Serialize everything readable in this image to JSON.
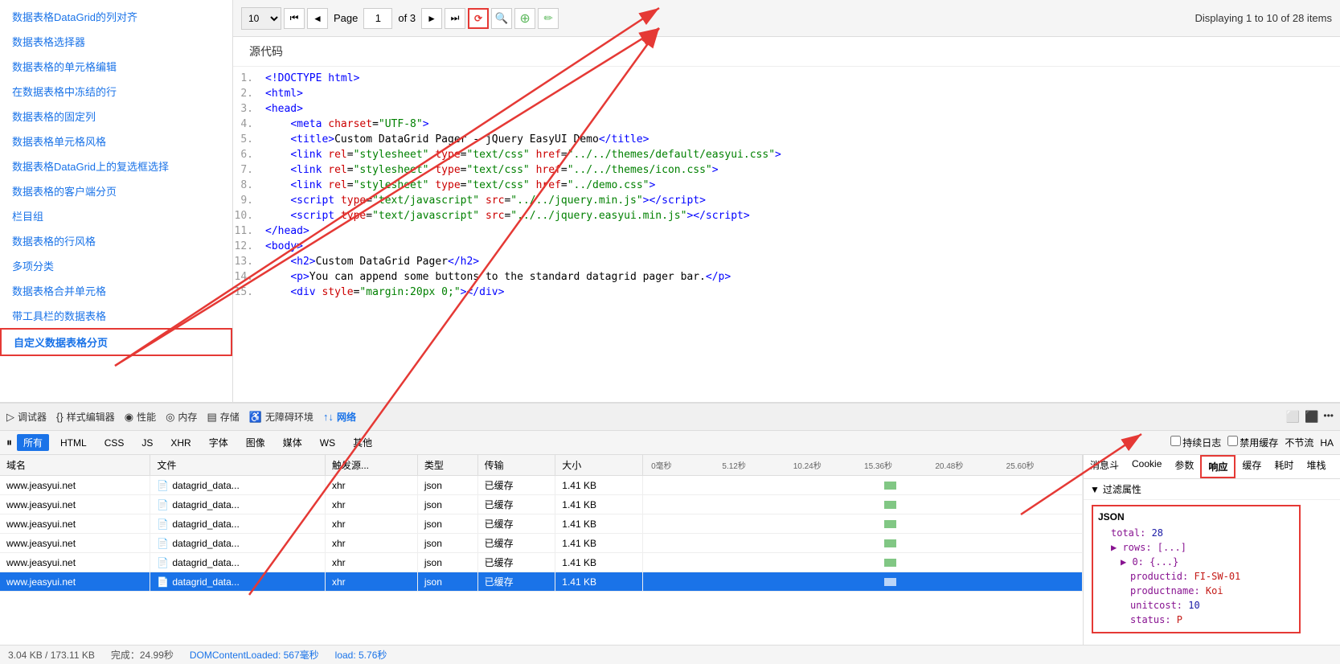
{
  "sidebar": {
    "items": [
      {
        "label": "数据表格DataGrid的列对齐",
        "active": false
      },
      {
        "label": "数据表格选择器",
        "active": false
      },
      {
        "label": "数据表格的单元格编辑",
        "active": false
      },
      {
        "label": "在数据表格中冻结的行",
        "active": false
      },
      {
        "label": "数据表格的固定列",
        "active": false
      },
      {
        "label": "数据表格单元格风格",
        "active": false
      },
      {
        "label": "数据表格DataGrid上的复选框选择",
        "active": false
      },
      {
        "label": "数据表格的客户端分页",
        "active": false
      },
      {
        "label": "栏目组",
        "active": false
      },
      {
        "label": "数据表格的行风格",
        "active": false
      },
      {
        "label": "多项分类",
        "active": false
      },
      {
        "label": "数据表格合并单元格",
        "active": false
      },
      {
        "label": "带工具栏的数据表格",
        "active": false
      },
      {
        "label": "自定义数据表格分页",
        "active": true
      }
    ]
  },
  "pager": {
    "page_size": "10",
    "current_page": "1",
    "of_label": "of 3",
    "display_text": "Displaying 1 to 10 of 28 items"
  },
  "source": {
    "header": "源代码",
    "lines": [
      {
        "num": "1.",
        "html": "<span class='code-blue'>&lt;!DOCTYPE html&gt;</span>"
      },
      {
        "num": "2.",
        "html": "<span class='code-blue'>&lt;html&gt;</span>"
      },
      {
        "num": "3.",
        "html": "<span class='code-blue'>&lt;head&gt;</span>"
      },
      {
        "num": "4.",
        "html": "    <span class='code-blue'>&lt;meta</span> <span class='code-red'>charset</span><span class='code-black'>=</span><span class='code-green'>\"UTF-8\"</span><span class='code-blue'>&gt;</span>"
      },
      {
        "num": "5.",
        "html": "    <span class='code-blue'>&lt;title&gt;</span><span class='code-black'>Custom DataGrid Pager - jQuery EasyUI Demo</span><span class='code-blue'>&lt;/title&gt;</span>"
      },
      {
        "num": "6.",
        "html": "    <span class='code-blue'>&lt;link</span> <span class='code-red'>rel</span><span class='code-black'>=</span><span class='code-green'>\"stylesheet\"</span> <span class='code-red'>type</span><span class='code-black'>=</span><span class='code-green'>\"text/css\"</span> <span class='code-red'>href</span><span class='code-black'>=</span><span class='code-green'>\"../../themes/default/easyui.css\"</span><span class='code-blue'>&gt;</span>"
      },
      {
        "num": "7.",
        "html": "    <span class='code-blue'>&lt;link</span> <span class='code-red'>rel</span><span class='code-black'>=</span><span class='code-green'>\"stylesheet\"</span> <span class='code-red'>type</span><span class='code-black'>=</span><span class='code-green'>\"text/css\"</span> <span class='code-red'>href</span><span class='code-black'>=</span><span class='code-green'>\"../../themes/icon.css\"</span><span class='code-blue'>&gt;</span>"
      },
      {
        "num": "8.",
        "html": "    <span class='code-blue'>&lt;link</span> <span class='code-red'>rel</span><span class='code-black'>=</span><span class='code-green'>\"stylesheet\"</span> <span class='code-red'>type</span><span class='code-black'>=</span><span class='code-green'>\"text/css\"</span> <span class='code-red'>href</span><span class='code-black'>=</span><span class='code-green'>\"../demo.css\"</span><span class='code-blue'>&gt;</span>"
      },
      {
        "num": "9.",
        "html": "    <span class='code-blue'>&lt;script</span> <span class='code-red'>type</span><span class='code-black'>=</span><span class='code-green'>\"text/javascript\"</span> <span class='code-red'>src</span><span class='code-black'>=</span><span class='code-green'>\"../../jquery.min.js\"</span><span class='code-blue'>&gt;&lt;/script&gt;</span>"
      },
      {
        "num": "10.",
        "html": "    <span class='code-blue'>&lt;script</span> <span class='code-red'>type</span><span class='code-black'>=</span><span class='code-green'>\"text/javascript\"</span> <span class='code-red'>src</span><span class='code-black'>=</span><span class='code-green'>\"../../jquery.easyui.min.js\"</span><span class='code-blue'>&gt;&lt;/script&gt;</span>"
      },
      {
        "num": "11.",
        "html": "<span class='code-blue'>&lt;/head&gt;</span>"
      },
      {
        "num": "12.",
        "html": "<span class='code-blue'>&lt;body&gt;</span>"
      },
      {
        "num": "13.",
        "html": "    <span class='code-blue'>&lt;h2&gt;</span><span class='code-black'>Custom DataGrid Pager</span><span class='code-blue'>&lt;/h2&gt;</span>"
      },
      {
        "num": "14.",
        "html": "    <span class='code-blue'>&lt;p&gt;</span><span class='code-black'>You can append some buttons to the standard datagrid pager bar.</span><span class='code-blue'>&lt;/p&gt;</span>"
      },
      {
        "num": "15.",
        "html": "    <span class='code-blue'>&lt;div</span> <span class='code-red'>style</span><span class='code-black'>=</span><span class='code-green'>\"margin:20px 0;\"</span><span class='code-blue'>&gt;&lt;/div&gt;</span>"
      }
    ]
  },
  "devtools": {
    "tools": [
      {
        "label": "调试器",
        "icon": "▷"
      },
      {
        "label": "样式编辑器",
        "icon": "{}"
      },
      {
        "label": "性能",
        "icon": "◉"
      },
      {
        "label": "内存",
        "icon": "◎"
      },
      {
        "label": "存储",
        "icon": "▤"
      },
      {
        "label": "无障碍环境",
        "icon": "♿"
      },
      {
        "label": "网络",
        "icon": "↑↓",
        "active": true
      }
    ]
  },
  "network": {
    "tabs": [
      "所有",
      "HTML",
      "CSS",
      "JS",
      "XHR",
      "字体",
      "图像",
      "媒体",
      "WS",
      "其他"
    ],
    "active_tab": "所有",
    "checkboxes": [
      {
        "label": "持续日志"
      },
      {
        "label": "禁用缓存"
      },
      {
        "label": "不节流"
      },
      {
        "label": "HA"
      }
    ],
    "columns": [
      "域名",
      "文件",
      "触发源...",
      "类型",
      "传输",
      "大小"
    ],
    "timeline_labels": [
      "0毫秒",
      "5.12秒",
      "10.24秒",
      "15.36秒",
      "20.48秒",
      "25.60秒"
    ],
    "right_tabs": [
      "消息斗",
      "Cookie",
      "参数",
      "响应",
      "缓存",
      "耗时",
      "堆栈"
    ],
    "active_right_tab": "响应",
    "rows": [
      {
        "domain": "www.jeasyui.net",
        "file": "datagrid_data...",
        "trigger": "xhr",
        "type": "json",
        "transfer": "已缓存",
        "size": "1.41 KB",
        "selected": false
      },
      {
        "domain": "www.jeasyui.net",
        "file": "datagrid_data...",
        "trigger": "xhr",
        "type": "json",
        "transfer": "已缓存",
        "size": "1.41 KB",
        "selected": false
      },
      {
        "domain": "www.jeasyui.net",
        "file": "datagrid_data...",
        "trigger": "xhr",
        "type": "json",
        "transfer": "已缓存",
        "size": "1.41 KB",
        "selected": false
      },
      {
        "domain": "www.jeasyui.net",
        "file": "datagrid_data...",
        "trigger": "xhr",
        "type": "json",
        "transfer": "已缓存",
        "size": "1.41 KB",
        "selected": false
      },
      {
        "domain": "www.jeasyui.net",
        "file": "datagrid_data...",
        "trigger": "xhr",
        "type": "json",
        "transfer": "已缓存",
        "size": "1.41 KB",
        "selected": false
      },
      {
        "domain": "www.jeasyui.net",
        "file": "datagrid_data...",
        "trigger": "xhr",
        "type": "json",
        "transfer": "已缓存",
        "size": "1.41 KB",
        "selected": true
      }
    ],
    "filter_label": "▼ 过滤属性",
    "json_section": {
      "title": "JSON",
      "total_label": "total:",
      "total_value": "28",
      "rows_label": "rows: [...]",
      "item_label": "▶ 0: {...}",
      "productid_label": "productid: FI-SW-01",
      "productname_label": "productname: Koi",
      "unitcost_label": "unitcost: 10",
      "status_label": "status: P"
    }
  },
  "statusbar": {
    "size": "3.04 KB / 173.11 KB",
    "complete": "完成：24.99秒",
    "dom": "DOMContentLoaded: 567毫秒",
    "load": "load: 5.76秒"
  }
}
